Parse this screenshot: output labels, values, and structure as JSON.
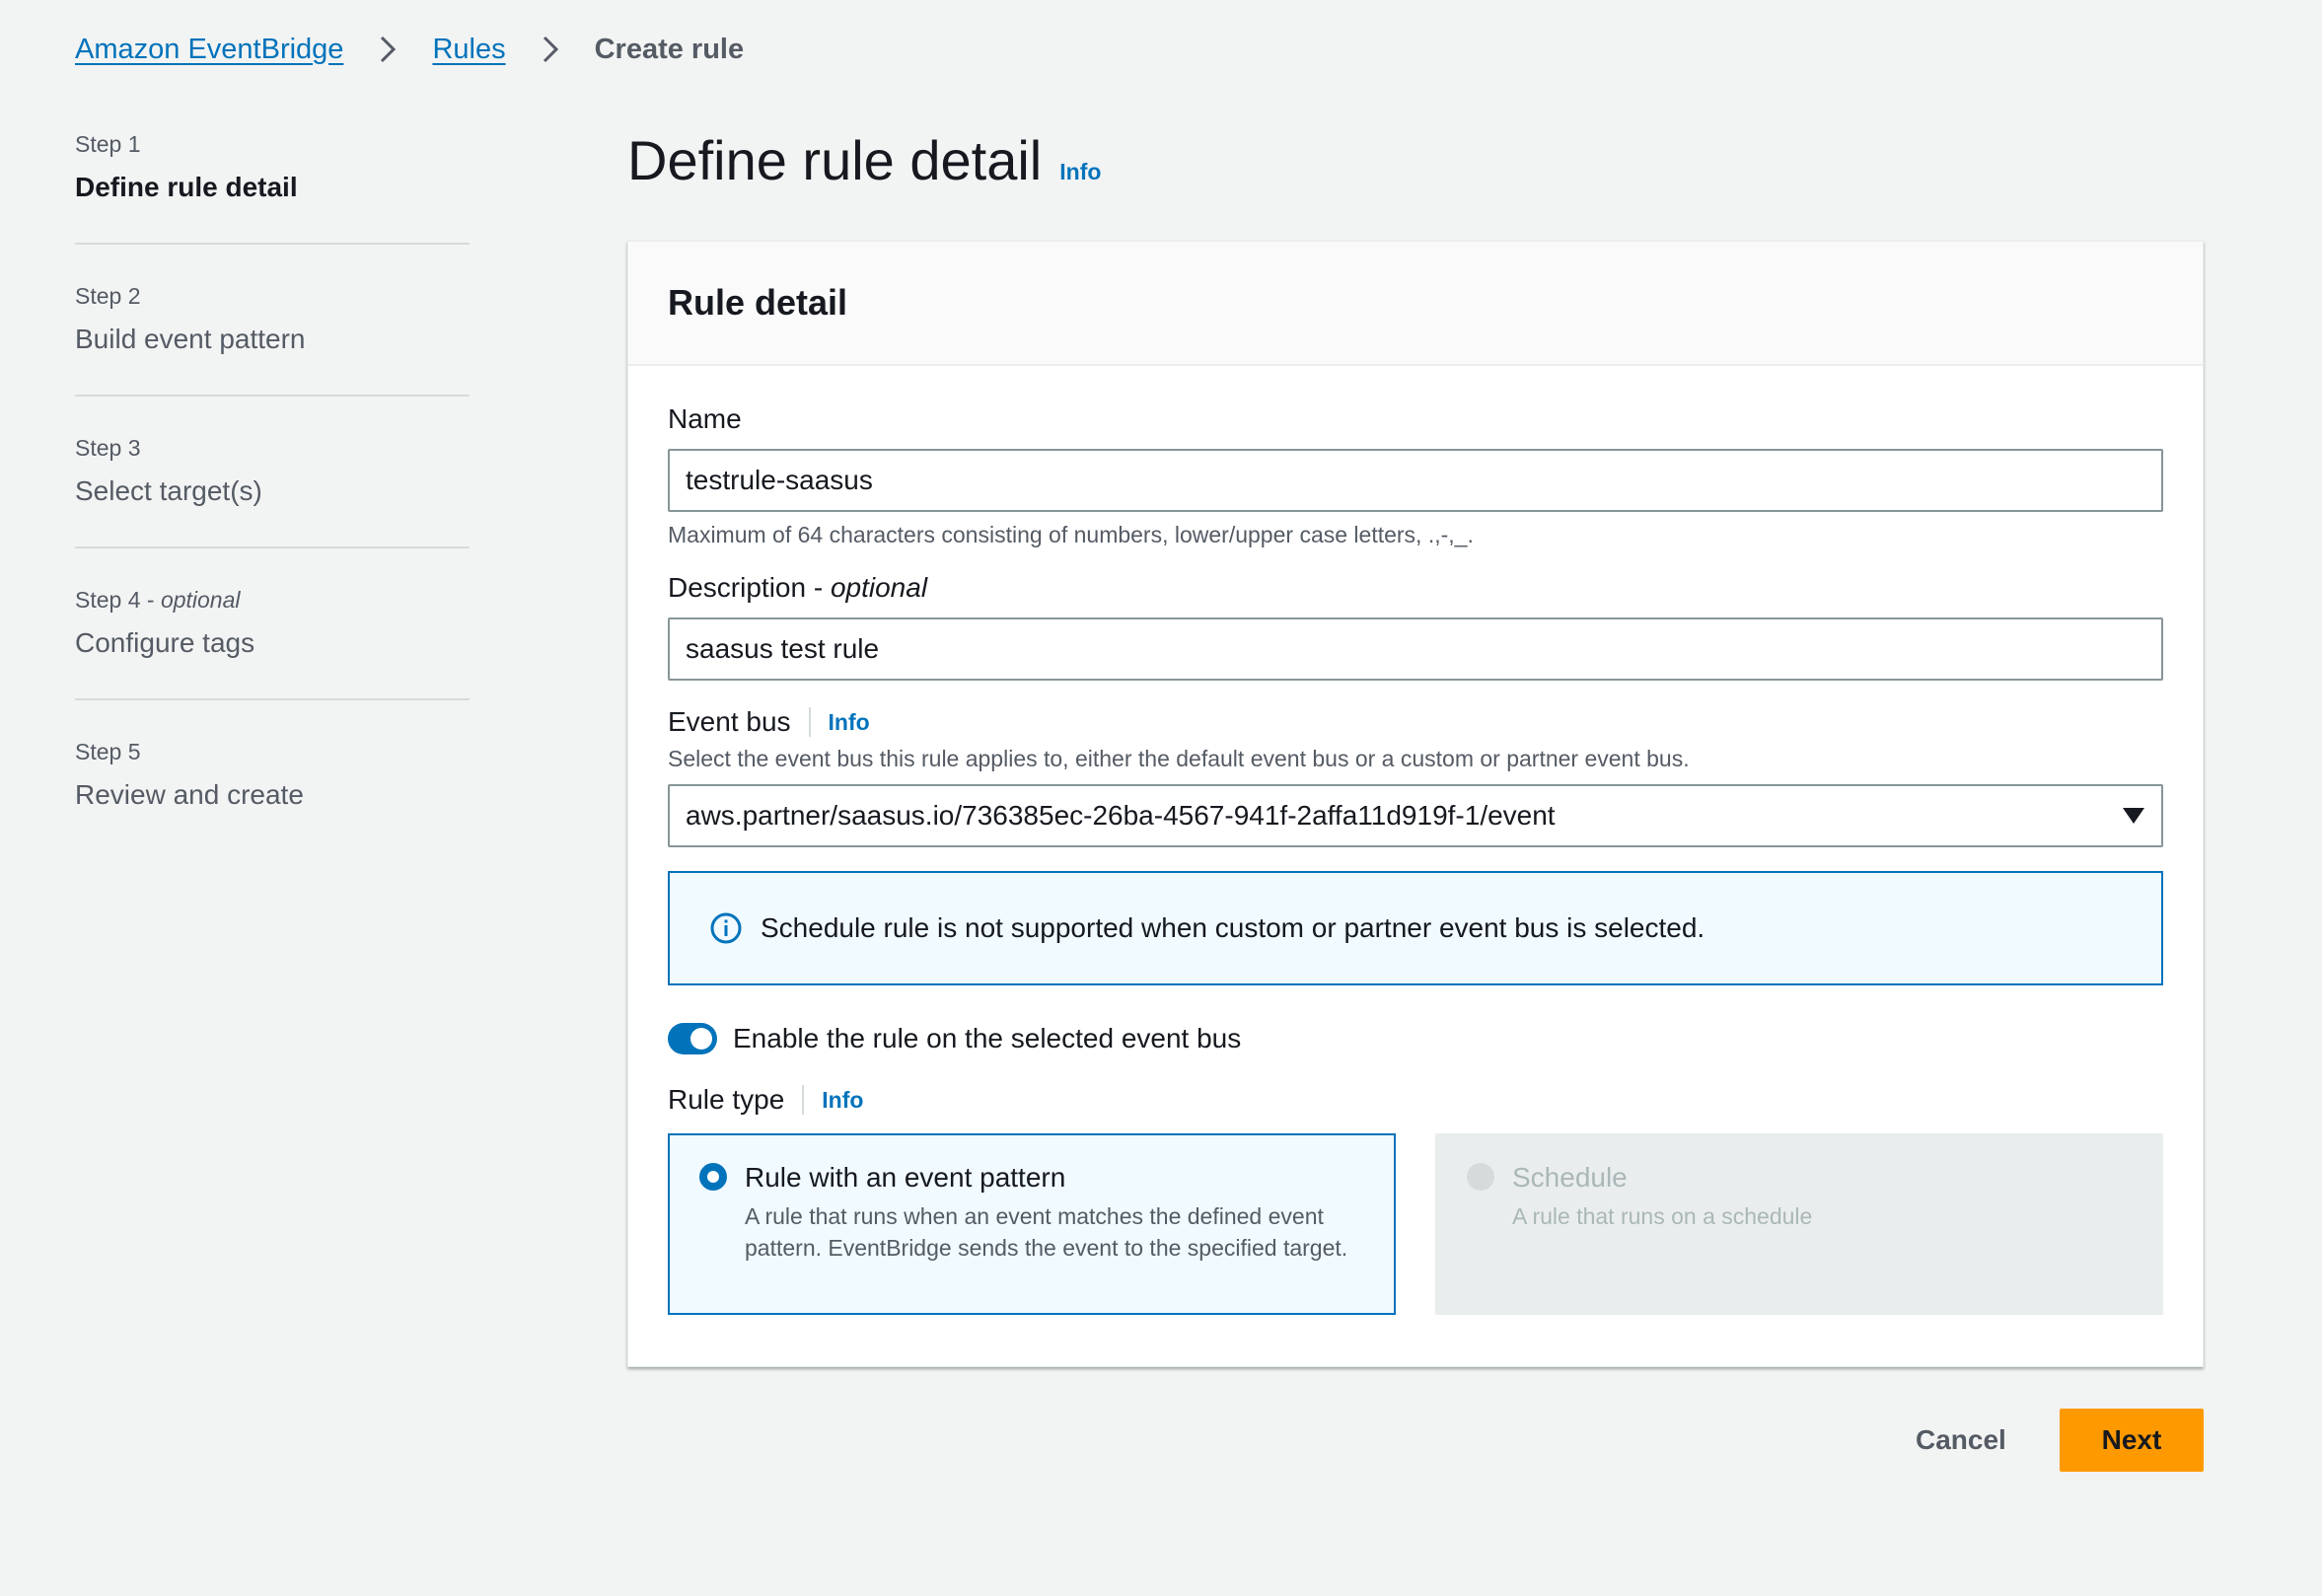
{
  "breadcrumb": {
    "items": [
      "Amazon EventBridge",
      "Rules"
    ],
    "current": "Create rule"
  },
  "steps": [
    {
      "num": "Step 1",
      "optional": "",
      "title": "Define rule detail",
      "active": true
    },
    {
      "num": "Step 2",
      "optional": "",
      "title": "Build event pattern",
      "active": false
    },
    {
      "num": "Step 3",
      "optional": "",
      "title": "Select target(s)",
      "active": false
    },
    {
      "num": "Step 4 - ",
      "optional": "optional",
      "title": "Configure tags",
      "active": false
    },
    {
      "num": "Step 5",
      "optional": "",
      "title": "Review and create",
      "active": false
    }
  ],
  "page": {
    "title": "Define rule detail",
    "info": "Info"
  },
  "panel": {
    "header": "Rule detail",
    "name": {
      "label": "Name",
      "value": "testrule-saasus",
      "hint": "Maximum of 64 characters consisting of numbers, lower/upper case letters, .,-,_."
    },
    "description": {
      "label": "Description - ",
      "optional": "optional",
      "value": "saasus test rule"
    },
    "event_bus": {
      "label": "Event bus",
      "info": "Info",
      "hint": "Select the event bus this rule applies to, either the default event bus or a custom or partner event bus.",
      "value": "aws.partner/saasus.io/736385ec-26ba-4567-941f-2affa11d919f-1/event"
    },
    "alert": "Schedule rule is not supported when custom or partner event bus is selected.",
    "toggle": {
      "label": "Enable the rule on the selected event bus",
      "on": true
    },
    "rule_type": {
      "label": "Rule type",
      "info": "Info",
      "options": [
        {
          "title": "Rule with an event pattern",
          "desc": "A rule that runs when an event matches the defined event pattern. EventBridge sends the event to the specified target.",
          "selected": true
        },
        {
          "title": "Schedule",
          "desc": "A rule that runs on a schedule",
          "selected": false,
          "disabled": true
        }
      ]
    }
  },
  "actions": {
    "cancel": "Cancel",
    "next": "Next"
  },
  "colors": {
    "link": "#0073bb",
    "primary_button": "#ff9900",
    "background": "#f2f3f3"
  }
}
